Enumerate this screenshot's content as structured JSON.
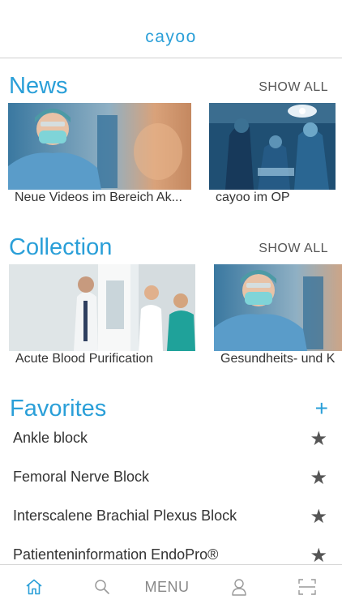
{
  "app": {
    "logo": "cayoo"
  },
  "news": {
    "title": "News",
    "show_all": "SHOW ALL",
    "items": [
      {
        "label": "Neue Videos im Bereich Ak..."
      },
      {
        "label": "cayoo im OP"
      }
    ]
  },
  "collection": {
    "title": "Collection",
    "show_all": "SHOW ALL",
    "items": [
      {
        "label": "Acute Blood Purification"
      },
      {
        "label": "Gesundheits- und K"
      }
    ]
  },
  "favorites": {
    "title": "Favorites",
    "add": "+",
    "items": [
      {
        "label": "Ankle block",
        "star": "★"
      },
      {
        "label": "Femoral Nerve Block",
        "star": "★"
      },
      {
        "label": "Interscalene Brachial Plexus Block",
        "star": "★"
      },
      {
        "label": "Patienteninformation EndoPro®",
        "star": "★"
      }
    ]
  },
  "tabbar": {
    "menu_label": "MENU"
  },
  "colors": {
    "accent": "#2a9fd8",
    "text": "#333333",
    "muted": "#888888"
  }
}
